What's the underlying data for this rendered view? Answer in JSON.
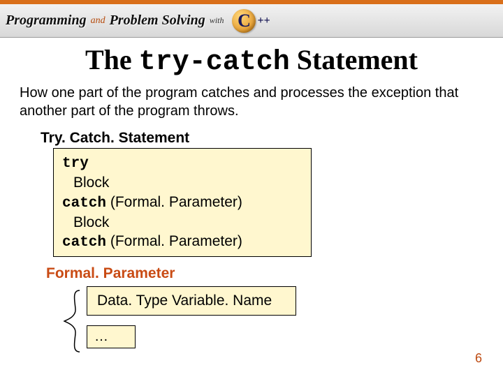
{
  "header": {
    "word1": "Programming",
    "and": "and",
    "word2": "Problem Solving",
    "with": "with",
    "logo_c": "C",
    "logo_plus": "++"
  },
  "title": {
    "pre": "The ",
    "mono": "try-catch",
    "post": "  Statement"
  },
  "subtitle": "How one part of the program catches and processes the exception that another part of the program throws.",
  "section1": {
    "label": "Try. Catch. Statement",
    "lines": {
      "l1": "try",
      "l2": "Block",
      "l3a": "catch",
      "l3b": " (Formal. Parameter)",
      "l4": "Block",
      "l5a": "catch",
      "l5b": " (Formal. Parameter)"
    }
  },
  "section2": {
    "label": "Formal. Parameter",
    "box1": "Data. Type Variable. Name",
    "box2": "…"
  },
  "page_number": "6"
}
